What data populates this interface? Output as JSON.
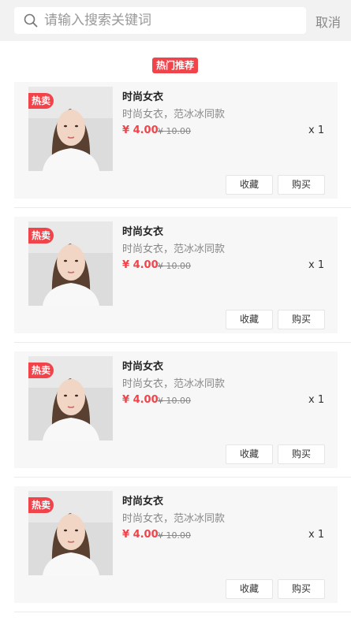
{
  "search": {
    "placeholder": "请输入搜索关键词",
    "cancel_label": "取消",
    "icon": "search-icon"
  },
  "section": {
    "tag": "热门推荐"
  },
  "products": [
    {
      "badge": "热卖",
      "title": "时尚女衣",
      "desc": "时尚女衣，范冰冰同款",
      "price": "¥ 4.00",
      "old_price": "¥ 10.00",
      "qty": "x 1",
      "fav_label": "收藏",
      "buy_label": "购买"
    },
    {
      "badge": "热卖",
      "title": "时尚女衣",
      "desc": "时尚女衣，范冰冰同款",
      "price": "¥ 4.00",
      "old_price": "¥ 10.00",
      "qty": "x 1",
      "fav_label": "收藏",
      "buy_label": "购买"
    },
    {
      "badge": "热卖",
      "title": "时尚女衣",
      "desc": "时尚女衣，范冰冰同款",
      "price": "¥ 4.00",
      "old_price": "¥ 10.00",
      "qty": "x 1",
      "fav_label": "收藏",
      "buy_label": "购买"
    },
    {
      "badge": "热卖",
      "title": "时尚女衣",
      "desc": "时尚女衣，范冰冰同款",
      "price": "¥ 4.00",
      "old_price": "¥ 10.00",
      "qty": "x 1",
      "fav_label": "收藏",
      "buy_label": "购买"
    }
  ],
  "colors": {
    "accent": "#f0434a",
    "background": "#f2f2f2",
    "card": "#f7f7f7"
  }
}
